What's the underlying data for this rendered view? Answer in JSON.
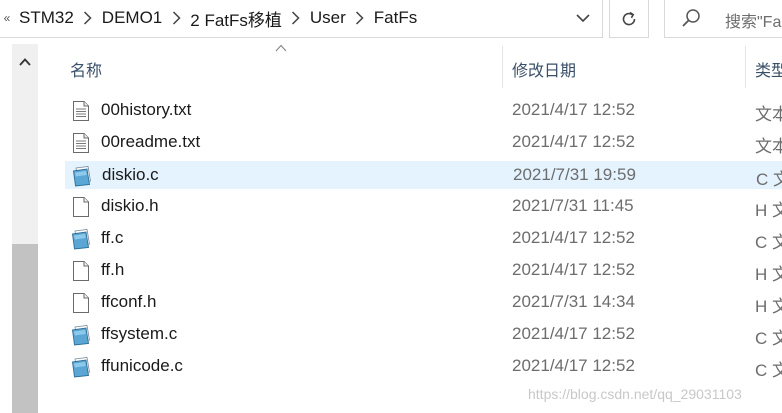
{
  "breadcrumb": {
    "overflow": "«",
    "items": [
      "STM32",
      "DEMO1",
      "2 FatFs移植",
      "User",
      "FatFs"
    ]
  },
  "search": {
    "placeholder": "搜索\"Fa"
  },
  "columns": {
    "name": "名称",
    "modified": "修改日期",
    "type": "类型"
  },
  "files": [
    {
      "name": "00history.txt",
      "modified": "2021/4/17 12:52",
      "type": "文本",
      "icon": "text-file-icon",
      "selected": false
    },
    {
      "name": "00readme.txt",
      "modified": "2021/4/17 12:52",
      "type": "文本",
      "icon": "text-file-icon",
      "selected": false
    },
    {
      "name": "diskio.c",
      "modified": "2021/7/31 19:59",
      "type": "C 文",
      "icon": "c-source-file-icon",
      "selected": true
    },
    {
      "name": "diskio.h",
      "modified": "2021/7/31 11:45",
      "type": "H 文",
      "icon": "header-file-icon",
      "selected": false
    },
    {
      "name": "ff.c",
      "modified": "2021/4/17 12:52",
      "type": "C 文",
      "icon": "c-source-file-icon",
      "selected": false
    },
    {
      "name": "ff.h",
      "modified": "2021/4/17 12:52",
      "type": "H 文",
      "icon": "header-file-icon",
      "selected": false
    },
    {
      "name": "ffconf.h",
      "modified": "2021/7/31 14:34",
      "type": "H 文",
      "icon": "header-file-icon",
      "selected": false
    },
    {
      "name": "ffsystem.c",
      "modified": "2021/4/17 12:52",
      "type": "C 文",
      "icon": "c-source-file-icon",
      "selected": false
    },
    {
      "name": "ffunicode.c",
      "modified": "2021/4/17 12:52",
      "type": "C 文",
      "icon": "c-source-file-icon",
      "selected": false
    }
  ],
  "watermark": "https://blog.csdn.net/qq_29031103",
  "colors": {
    "selection": "#e5f3ff",
    "header_text": "#3a5068",
    "date_text": "#6d6d6d"
  }
}
